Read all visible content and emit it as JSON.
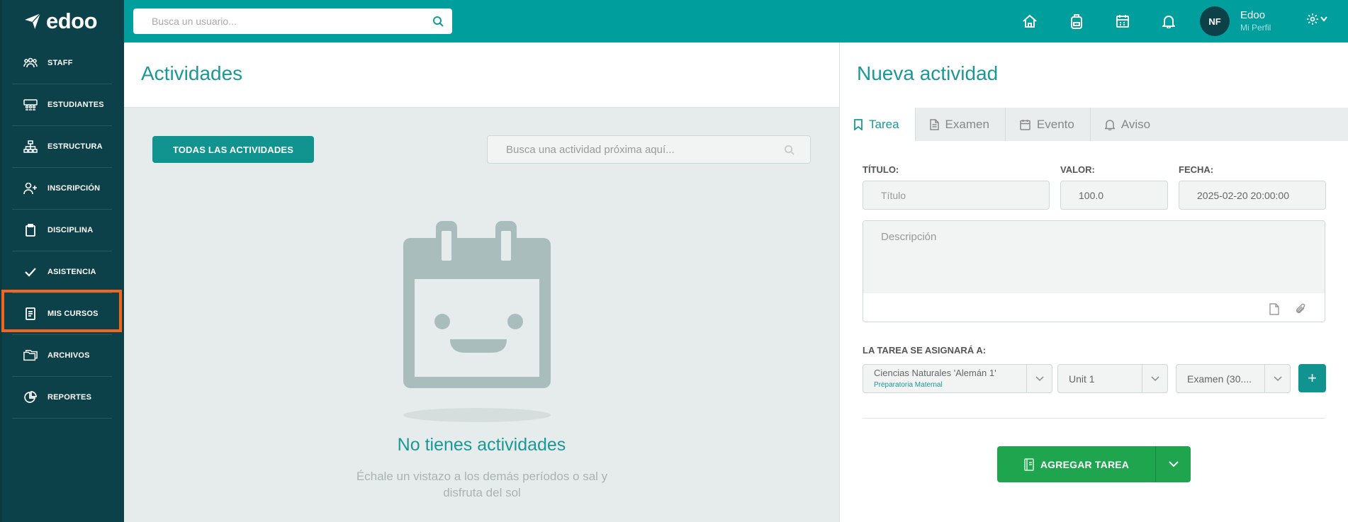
{
  "brand": {
    "name": "edoo"
  },
  "sidebar": {
    "items": [
      {
        "label": "STAFF",
        "icon": "staff-icon"
      },
      {
        "label": "ESTUDIANTES",
        "icon": "students-icon"
      },
      {
        "label": "ESTRUCTURA",
        "icon": "structure-icon"
      },
      {
        "label": "INSCRIPCIÓN",
        "icon": "add-user-icon"
      },
      {
        "label": "DISCIPLINA",
        "icon": "clipboard-icon"
      },
      {
        "label": "ASISTENCIA",
        "icon": "check-icon"
      },
      {
        "label": "MIS CURSOS",
        "icon": "book-icon"
      },
      {
        "label": "ARCHIVOS",
        "icon": "folder-icon"
      },
      {
        "label": "REPORTES",
        "icon": "pie-chart-icon"
      }
    ],
    "highlight_color": "#f26522"
  },
  "topbar": {
    "search_placeholder": "Busca un usuario...",
    "user_initials": "NF",
    "user_name": "Edoo",
    "user_sub": "Mi Perfil",
    "bg_color": "#009e9d"
  },
  "activities": {
    "title": "Actividades",
    "all_button": "TODAS LAS ACTIVIDADES",
    "search_placeholder": "Busca una actividad próxima aquí...",
    "empty_title": "No tienes actividades",
    "empty_sub": "Échale un vistazo a los demás períodos o sal y disfruta del sol"
  },
  "new_activity": {
    "title": "Nueva actividad",
    "tabs": [
      {
        "label": "Tarea",
        "icon": "bookmark-icon",
        "active": true
      },
      {
        "label": "Examen",
        "icon": "document-icon",
        "active": false
      },
      {
        "label": "Evento",
        "icon": "calendar-icon",
        "active": false
      },
      {
        "label": "Aviso",
        "icon": "bell-icon",
        "active": false
      }
    ],
    "title_label": "TÍTULO:",
    "title_placeholder": "Título",
    "value_label": "VALOR:",
    "value": "100.0",
    "date_label": "FECHA:",
    "date": "2025-02-20 20:00:00",
    "description_placeholder": "Descripción",
    "assign_label": "LA TAREA SE ASIGNARÁ A:",
    "course": "Ciencias Naturales 'Alemán 1'",
    "course_sub": "Preparatoria Maternal",
    "unit": "Unit 1",
    "exam": "Examen (30....",
    "submit_label": "AGREGAR TAREA"
  }
}
